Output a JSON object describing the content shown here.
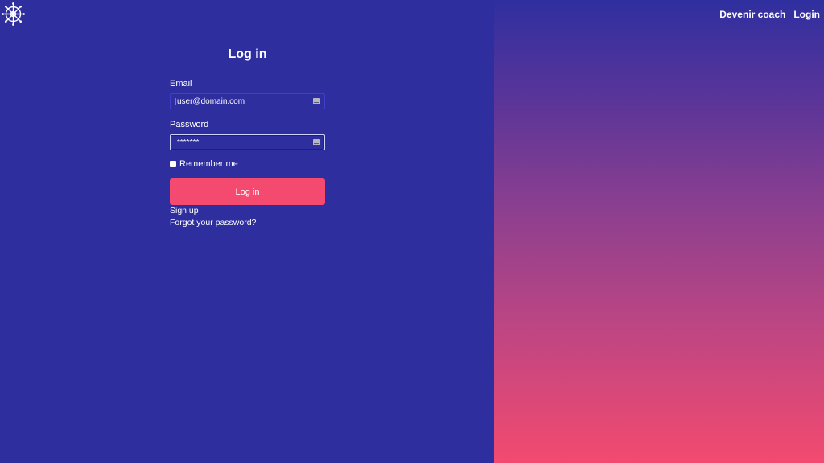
{
  "nav": {
    "become_coach": "Devenir coach",
    "login": "Login"
  },
  "form": {
    "title": "Log in",
    "email_label": "Email",
    "email_value": "user@domain.com",
    "password_label": "Password",
    "password_value": "*******",
    "remember_label": "Remember me",
    "submit_label": "Log in",
    "signup_link": "Sign up",
    "forgot_link": "Forgot your password?"
  },
  "colors": {
    "background": "#2e2e9f",
    "accent": "#f54a70",
    "gradient_top": "#2f2f9f",
    "gradient_bottom": "#f34a6f"
  },
  "icons": {
    "logo": "ship-wheel-icon",
    "autofill": "autofill-key-icon"
  }
}
